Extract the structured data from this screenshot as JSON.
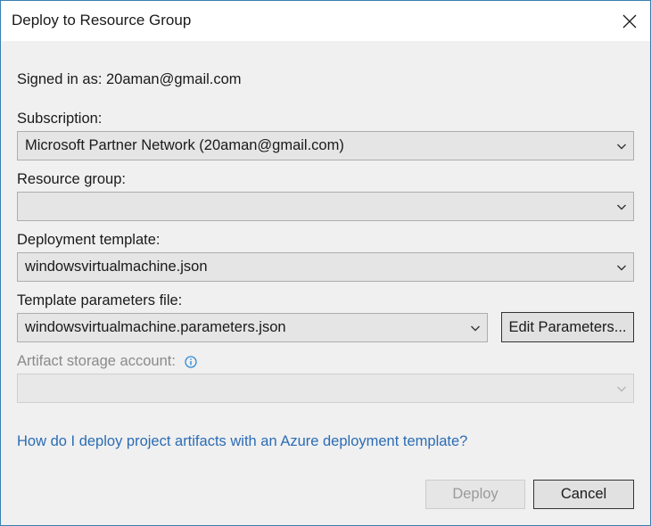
{
  "window": {
    "title": "Deploy to Resource Group",
    "close_icon": "close-icon"
  },
  "account": {
    "signed_in_text": "Signed in as: 20aman@gmail.com"
  },
  "subscription": {
    "label": "Subscription:",
    "value": "Microsoft Partner Network (20aman@gmail.com)"
  },
  "resource_group": {
    "label": "Resource group:",
    "value": ""
  },
  "deployment_template": {
    "label": "Deployment template:",
    "value": "windowsvirtualmachine.json"
  },
  "template_parameters": {
    "label": "Template parameters file:",
    "value": "windowsvirtualmachine.parameters.json",
    "edit_button": "Edit Parameters..."
  },
  "artifact_storage": {
    "label": "Artifact storage account:",
    "value": "",
    "info_icon": "info-icon",
    "disabled": true
  },
  "help": {
    "link_text": "How do I deploy project artifacts with an Azure deployment template?"
  },
  "footer": {
    "deploy_label": "Deploy",
    "deploy_disabled": true,
    "cancel_label": "Cancel"
  },
  "colors": {
    "accent_border": "#3c7fb1",
    "link": "#2b6cb5",
    "info_icon": "#2e8ad8",
    "disabled_text": "#8a8a8a",
    "background": "#f0f0f0"
  }
}
